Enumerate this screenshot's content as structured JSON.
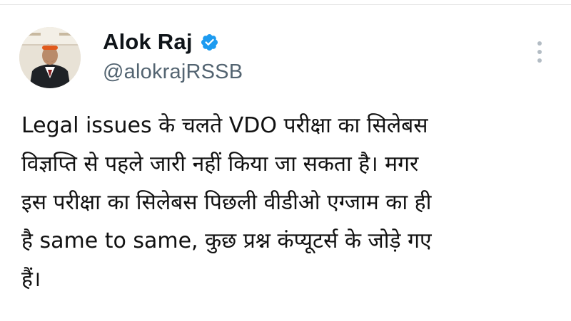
{
  "tweet": {
    "author": {
      "display_name": "Alok Raj",
      "handle": "@alokrajRSSB",
      "verified": true,
      "avatar_icon": "profile-photo"
    },
    "text_lines": [
      "Legal issues के चलते VDO परीक्षा का सिलेबस",
      "विज्ञप्ति से पहले जारी नहीं किया जा सकता है। मगर",
      "इस परीक्षा का सिलेबस पिछली वीडीओ एग्जाम का ही",
      "है same to same, कुछ प्रश्न कंप्यूटर्स के जोड़े गए",
      "हैं।"
    ],
    "more_options_icon": "vertical-dots-icon"
  },
  "colors": {
    "verified_badge": "#1d9bf0",
    "handle_text": "#536471",
    "body_text": "#111111",
    "more_icon": "#b3bcc4"
  }
}
